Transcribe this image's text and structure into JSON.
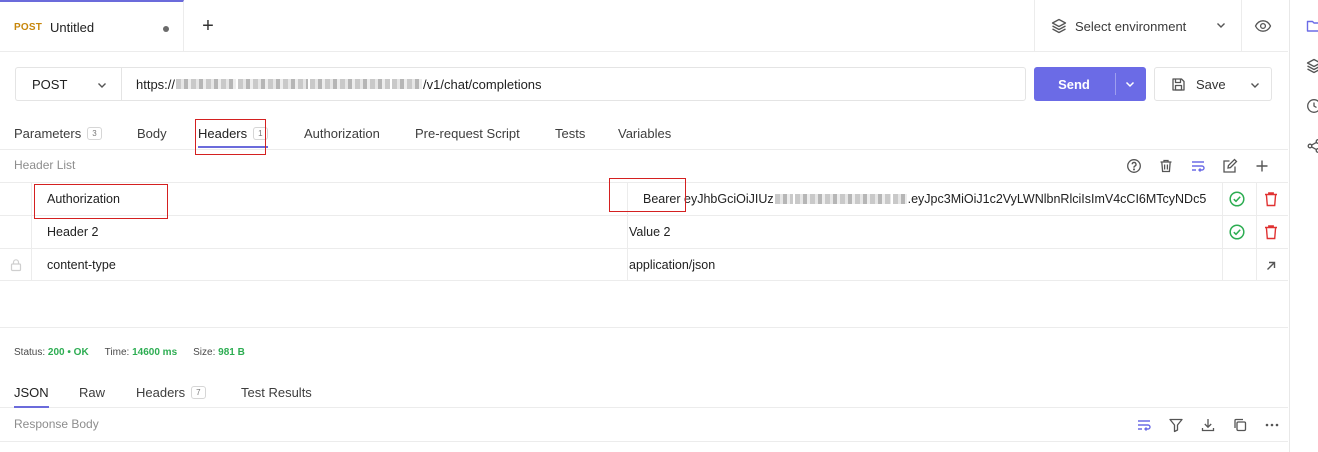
{
  "request_tab": {
    "method": "POST",
    "title": "Untitled"
  },
  "environment": {
    "label": "Select environment"
  },
  "request": {
    "method": "POST",
    "url_prefix": "https://",
    "url_suffix": "/v1/chat/completions"
  },
  "toolbar": {
    "send_label": "Send",
    "save_label": "Save"
  },
  "request_tabs": [
    {
      "label": "Parameters",
      "count": "3"
    },
    {
      "label": "Body",
      "count": ""
    },
    {
      "label": "Headers",
      "count": "1"
    },
    {
      "label": "Authorization",
      "count": ""
    },
    {
      "label": "Pre-request Script",
      "count": ""
    },
    {
      "label": "Tests",
      "count": ""
    },
    {
      "label": "Variables",
      "count": ""
    }
  ],
  "header_list": {
    "title": "Header List",
    "rows": [
      {
        "key": "Authorization",
        "value_prefix": "Bearer ",
        "value_start": "eyJhbGciOiJIUz",
        "value_mid": ".eyJpc3MiOiJ1c2VyLWNlbnRlciIsImV4cCI6MTcyNDc5"
      },
      {
        "key_placeholder": "Header 2",
        "value_placeholder": "Value 2"
      },
      {
        "key_placeholder": "content-type",
        "value_placeholder": "application/json"
      }
    ]
  },
  "response": {
    "status_label": "Status:",
    "status_value": "200 • OK",
    "time_label": "Time:",
    "time_value": "14600 ms",
    "size_label": "Size:",
    "size_value": "981 B",
    "tabs": [
      {
        "label": "JSON",
        "count": ""
      },
      {
        "label": "Raw",
        "count": ""
      },
      {
        "label": "Headers",
        "count": "7"
      },
      {
        "label": "Test Results",
        "count": ""
      }
    ],
    "body_title": "Response Body"
  },
  "colors": {
    "accent": "#6b6be6",
    "success": "#2dad52",
    "danger": "#e03131",
    "method_badge": "#c7860a"
  }
}
